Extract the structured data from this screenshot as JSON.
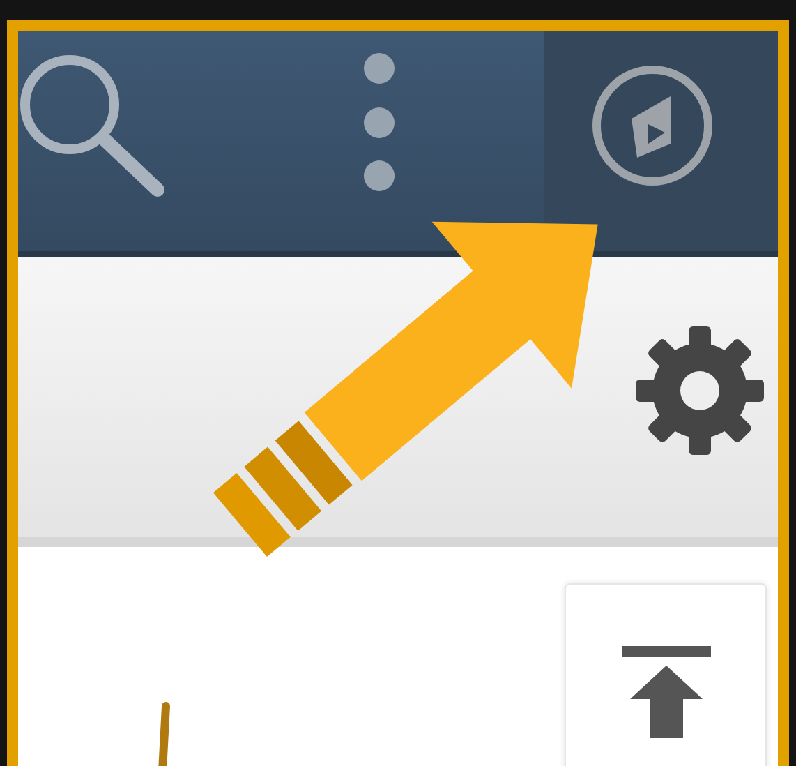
{
  "annotations": [
    {
      "kind": "arrow",
      "color": "#fbb11b"
    },
    {
      "kind": "line",
      "color": "#b07a10"
    }
  ]
}
